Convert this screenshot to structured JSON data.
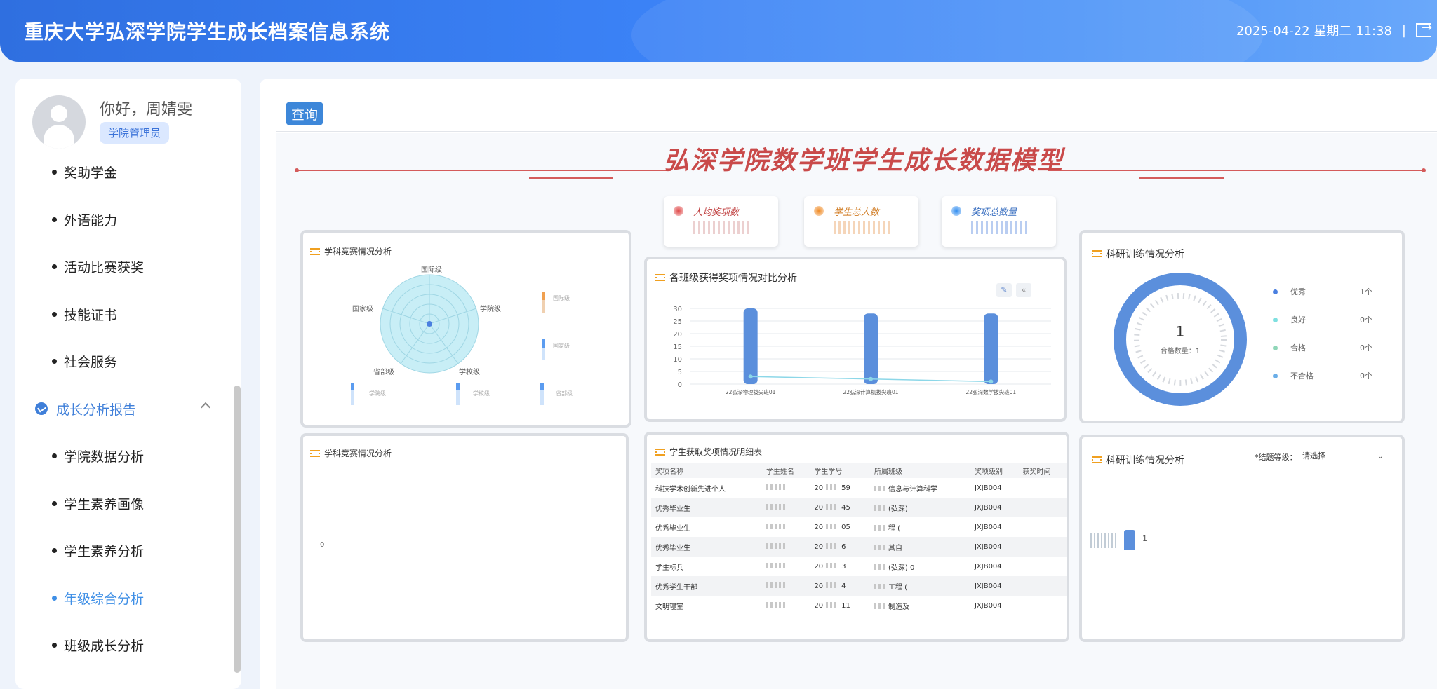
{
  "header": {
    "title": "重庆大学弘深学院学生成长档案信息系统",
    "datetime": "2025-04-22 星期二 11:38",
    "divider": "|"
  },
  "user": {
    "greeting": "你好，周婧雯",
    "role": "学院管理员"
  },
  "menu": {
    "items_top": [
      "奖助学金",
      "外语能力",
      "活动比赛获奖",
      "技能证书",
      "社会服务"
    ],
    "group_label": "成长分析报告",
    "items_sub": [
      "学院数据分析",
      "学生素养画像",
      "学生素养分析",
      "年级综合分析",
      "班级成长分析"
    ],
    "active_item": "年级综合分析"
  },
  "toolbar": {
    "query_label": "查询"
  },
  "dashboard": {
    "title": "弘深学院数学班学生成长数据模型",
    "stats": [
      {
        "label": "人均奖项数",
        "color": "#e04848"
      },
      {
        "label": "学生总人数",
        "color": "#f08a24"
      },
      {
        "label": "奖项总数量",
        "color": "#2f8cf0"
      }
    ],
    "radar_panel": {
      "title": "学科竞赛情况分析",
      "axes": [
        "国际级",
        "学院级",
        "学校级",
        "省部级",
        "国家级"
      ],
      "side_bars": [
        "国际级",
        "国家级"
      ],
      "bottom_bars": [
        "学院级",
        "学校级",
        "省部级"
      ]
    },
    "bar_panel": {
      "title": "各班级获得奖项情况对比分析",
      "tool_icons": [
        "edit-icon",
        "collapse-icon"
      ]
    },
    "research_ring": {
      "title": "科研训练情况分析",
      "center_value": "1",
      "center_label": "合格数量：1",
      "legend": [
        {
          "name": "优秀",
          "value": "1个",
          "color": "#4a7fe0"
        },
        {
          "name": "良好",
          "value": "0个",
          "color": "#7fe0e0"
        },
        {
          "name": "合格",
          "value": "0个",
          "color": "#8fd6b8"
        },
        {
          "name": "不合格",
          "value": "0个",
          "color": "#6aaee8"
        }
      ]
    },
    "competition_empty": {
      "title": "学科竞赛情况分析",
      "zero_label": "0"
    },
    "awards_table": {
      "title": "学生获取奖项情况明细表",
      "columns": [
        "奖项名称",
        "学生姓名",
        "学生学号",
        "所属班级",
        "奖项级别",
        "获奖时间"
      ],
      "rows": [
        {
          "award": "科技学术创新先进个人",
          "id_a": "20",
          "id_b": "59",
          "cls": "信息与计算科学",
          "level": "JXJB004"
        },
        {
          "award": "优秀毕业生",
          "id_a": "20",
          "id_b": "45",
          "cls": "(弘深)",
          "level": "JXJB004"
        },
        {
          "award": "优秀毕业生",
          "id_a": "20",
          "id_b": "05",
          "cls": "程 (",
          "level": "JXJB004"
        },
        {
          "award": "优秀毕业生",
          "id_a": "20",
          "id_b": "6",
          "cls": "其自",
          "level": "JXJB004"
        },
        {
          "award": "学生标兵",
          "id_a": "20",
          "id_b": "3",
          "cls": "(弘深) 0",
          "level": "JXJB004"
        },
        {
          "award": "优秀学生干部",
          "id_a": "20",
          "id_b": "4",
          "cls": "工程 (",
          "level": "JXJB004"
        },
        {
          "award": "文明寝室",
          "id_a": "20",
          "id_b": "11",
          "cls": "制造及",
          "level": "JXJB004"
        }
      ]
    },
    "research_bar": {
      "title": "科研训练情况分析",
      "filter_label": "*结题等级：",
      "filter_placeholder": "请选择",
      "bar_value": "1"
    }
  },
  "chart_data": {
    "type": "bar",
    "title": "各班级获得奖项情况对比分析",
    "categories": [
      "22弘深物理拔尖班01",
      "22弘深计算机拔尖班01",
      "22弘深数学拔尖班01"
    ],
    "series": [
      {
        "values": [
          30,
          28,
          28
        ],
        "color": "#5b8fdc"
      },
      {
        "values": [
          3,
          2,
          1
        ],
        "color": "#8cd7e8"
      }
    ],
    "ylim": [
      0,
      30
    ],
    "yticks": [
      0,
      5,
      10,
      15,
      20,
      25,
      30
    ],
    "grid": true
  }
}
